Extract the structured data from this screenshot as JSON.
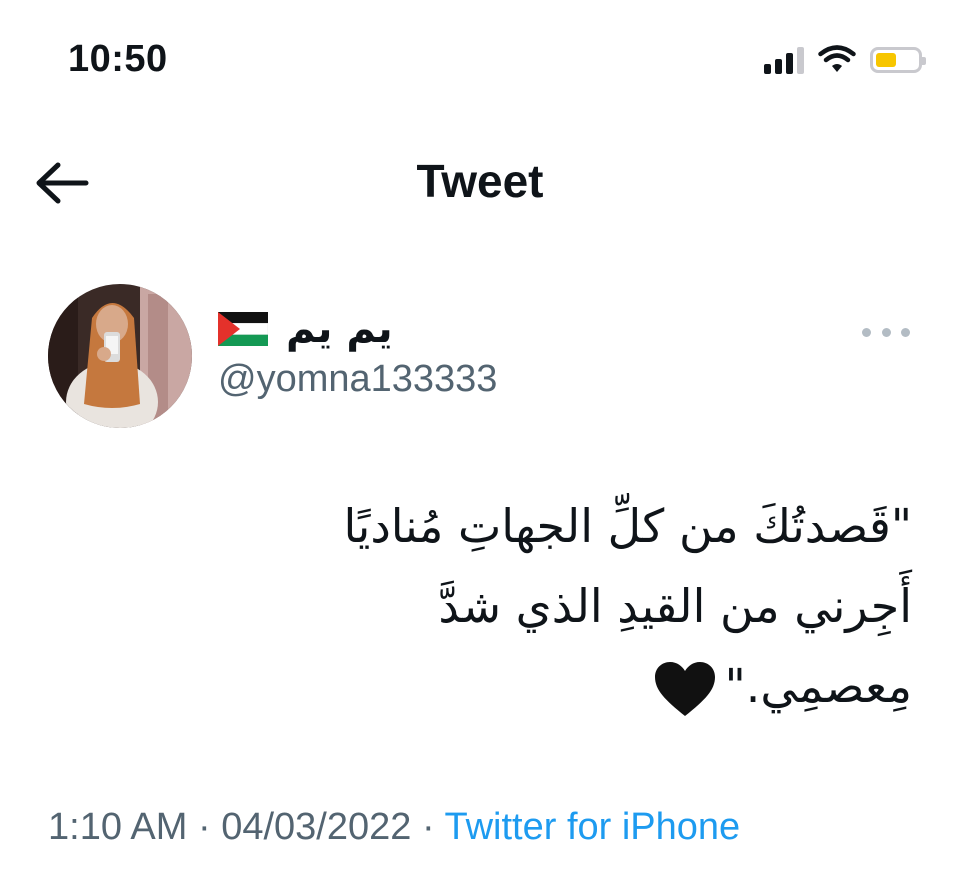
{
  "status_bar": {
    "time": "10:50",
    "icons": [
      "cellular-signal-icon",
      "wifi-icon",
      "battery-icon"
    ],
    "battery_color": "#f7c600"
  },
  "header": {
    "title": "Tweet",
    "back_icon": "arrow-left-icon"
  },
  "author": {
    "display_name": "يم يم",
    "flag_icon": "palestine-flag-icon",
    "handle": "@yomna133333",
    "more_icon": "more-horizontal-icon"
  },
  "tweet": {
    "lines": [
      "\"قَصدتُكَ من كلِّ الجهاتِ مُناديًا",
      "أَجِرني من القيدِ الذي شدَّ",
      "مِعصمِي.\""
    ],
    "emoji": "black-heart-icon"
  },
  "meta": {
    "time": "1:10 AM",
    "separator": "·",
    "date": "04/03/2022",
    "source": "Twitter for iPhone"
  },
  "colors": {
    "text": "#0f1419",
    "secondary": "#536471",
    "link": "#1d9bf0"
  }
}
